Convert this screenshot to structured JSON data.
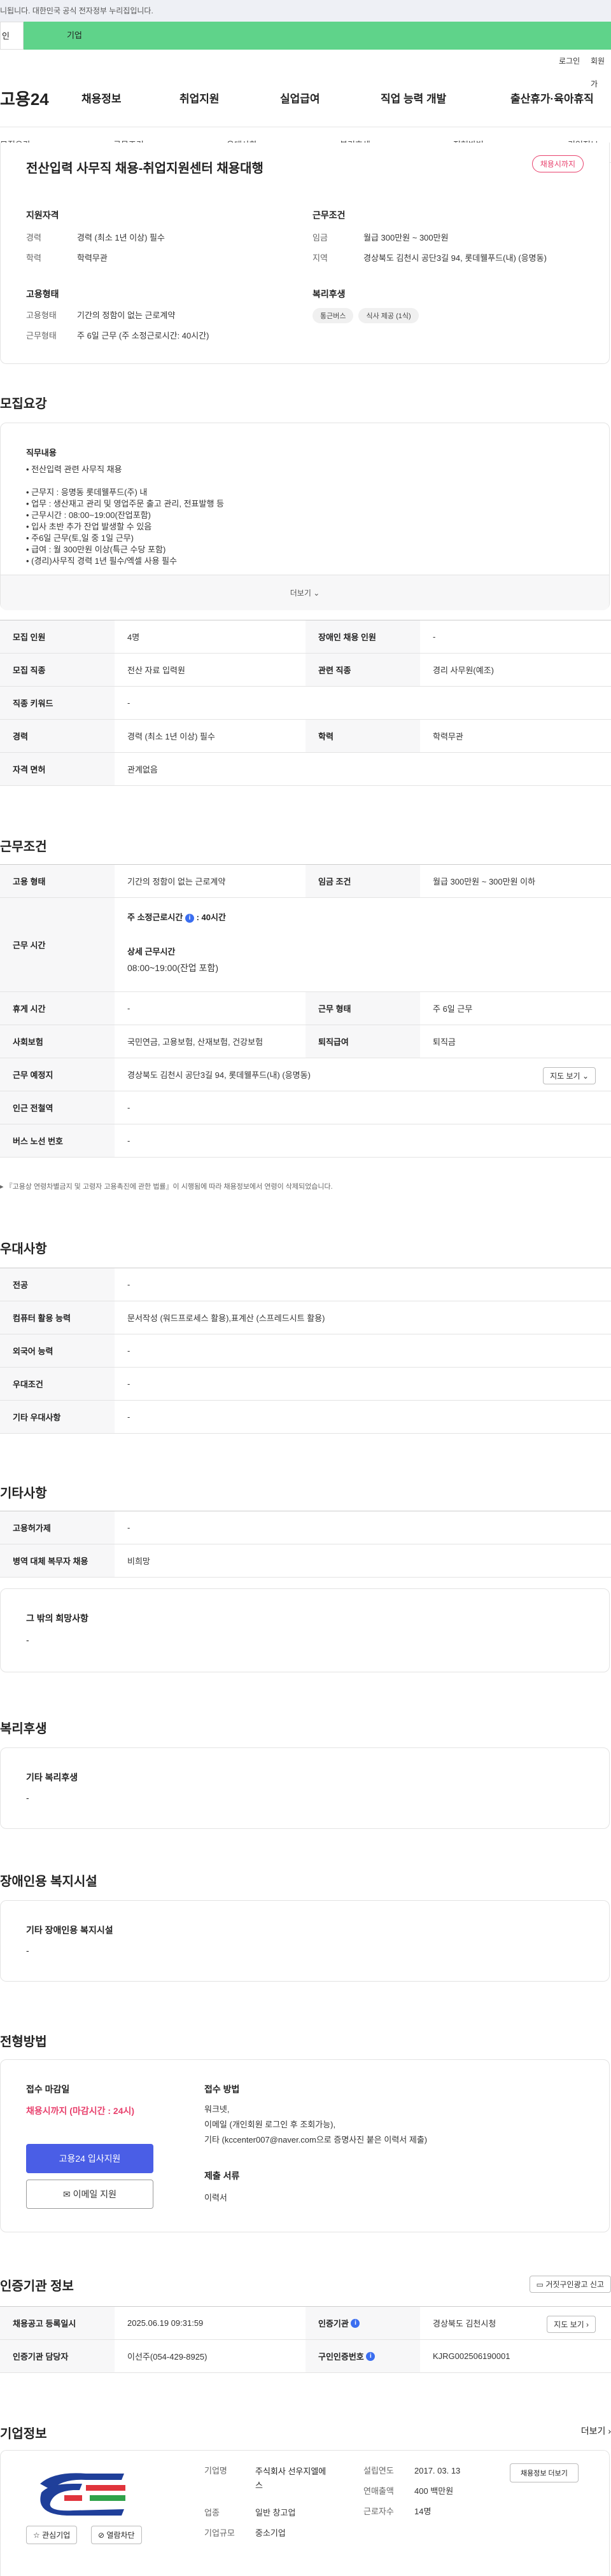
{
  "notice": "니됩니다. 대한민국 공식 전자정부 누리집입니다.",
  "tabs": {
    "individual": "인",
    "enterprise": "기업"
  },
  "util": {
    "login": "로그인",
    "join": "회원가"
  },
  "logo": "고용24",
  "gnb": [
    "채용정보",
    "취업지원",
    "실업급여",
    "직업 능력 개발",
    "출산휴가·육아휴직"
  ],
  "snb": [
    "모집요강",
    "근무조건",
    "우대사항",
    "복리후생",
    "전형방법",
    "기업정보"
  ],
  "job": {
    "title": "전산입력 사무직 채용-취업지원센터 채용대행",
    "badge": "채용시까지",
    "qual": {
      "heading": "지원자격",
      "rows": [
        {
          "k": "경력",
          "v": "경력 (최소 1년 이상) 필수"
        },
        {
          "k": "학력",
          "v": "학력무관"
        }
      ]
    },
    "cond": {
      "heading": "근무조건",
      "rows": [
        {
          "k": "임금",
          "v": "월급 300만원 ~ 300만원"
        },
        {
          "k": "지역",
          "v": "경상북도 김천시 공단3길 94, 롯데웰푸드(내) (응명동)"
        }
      ]
    },
    "emp": {
      "heading": "고용형태",
      "rows": [
        {
          "k": "고용형태",
          "v": "기간의 정함이 없는 근로계약"
        },
        {
          "k": "근무형태",
          "v": "주 6일 근무 (주 소정근로시간: 40시간)"
        }
      ]
    },
    "welfare": {
      "heading": "복리후생",
      "chips": [
        "통근버스",
        "식사 제공 (1식)"
      ]
    }
  },
  "recruit": {
    "heading": "모집요강",
    "desc_title": "직무내용",
    "desc_lines": [
      "• 전산입력 관련 사무직 채용",
      "",
      "• 근무지 : 응명동 롯데웰푸드(주) 내",
      "• 업무 : 생산재고 관리 및 영업주문 출고 관리, 전표발행 등",
      "• 근무시간 : 08:00~19:00(잔업포함)",
      "• 입사 초반 추가 잔업 발생할 수 있음",
      "• 주6일 근무(토,일 중 1일 근무)",
      "• 급여 : 월 300만원 이상(특근 수당 포함)",
      "• (경리)사무직 경력 1년 필수/엑셀 사용 필수"
    ],
    "more": "더보기",
    "rows": [
      {
        "l1": "모집 인원",
        "v1": "4명",
        "l2": "장애인 채용 인원",
        "v2": "-"
      },
      {
        "l1": "모집 직종",
        "v1": "전산 자료 입력원",
        "l2": "관련 직종",
        "v2": "경리 사무원(예조)"
      },
      {
        "l1": "직종 키워드",
        "v1": "-",
        "l2": "",
        "v2": ""
      },
      {
        "l1": "경력",
        "v1": "경력 (최소 1년 이상) 필수",
        "l2": "학력",
        "v2": "학력무관"
      },
      {
        "l1": "자격 면허",
        "v1": "관계없음",
        "l2": "",
        "v2": ""
      }
    ]
  },
  "work": {
    "heading": "근무조건",
    "r1": {
      "l1": "고용 형태",
      "v1": "기간의 정함이 없는 근로계약",
      "l2": "임금 조건",
      "v2": "월급 300만원 ~ 300만원 이하"
    },
    "hours": {
      "label": "근무 시간",
      "week_label": "주 소정근로시간",
      "week_val": ": 40시간",
      "detail_label": "상세 근무시간",
      "detail_val": "08:00~19:00(잔업 포함)"
    },
    "r3": {
      "l1": "휴게 시간",
      "v1": "-",
      "l2": "근무 형태",
      "v2": "주 6일 근무"
    },
    "r4": {
      "l1": "사회보험",
      "v1": "국민연금, 고용보험, 산재보험, 건강보험",
      "l2": "퇴직급여",
      "v2": "퇴직금"
    },
    "r5": {
      "l1": "근무 예정지",
      "v1": "경상북도 김천시 공단3길 94, 롯데웰푸드(내) (응명동)",
      "btn": "지도 보기"
    },
    "r6": {
      "l1": "인근 전철역",
      "v1": "-"
    },
    "r7": {
      "l1": "버스 노선 번호",
      "v1": "-"
    },
    "note": "『고용상 연령차별금지 및 고령자 고용촉진에 관한 법률』이 시행됨에 따라 채용정보에서 연령이 삭제되었습니다."
  },
  "pref": {
    "heading": "우대사항",
    "rows": [
      {
        "l": "전공",
        "v": "-"
      },
      {
        "l": "컴퓨터 활용 능력",
        "v": "문서작성 (워드프로세스 활용),표계산 (스프레드시트 활용)"
      },
      {
        "l": "외국어 능력",
        "v": "-"
      },
      {
        "l": "우대조건",
        "v": "-"
      },
      {
        "l": "기타 우대사항",
        "v": "-"
      }
    ]
  },
  "etc": {
    "heading": "기타사항",
    "rows": [
      {
        "l": "고용허가제",
        "v": "-"
      },
      {
        "l": "병역 대체 복무자 채용",
        "v": "비희망"
      }
    ],
    "wish_title": "그 밖의 희망사항",
    "wish_val": "-"
  },
  "welfare2": {
    "heading": "복리후생",
    "title": "기타 복리후생",
    "val": "-"
  },
  "disab": {
    "heading": "장애인용 복지시설",
    "title": "기타 장애인용 복지시설",
    "val": "-"
  },
  "process": {
    "heading": "전형방법",
    "deadline_title": "접수 마감일",
    "deadline_val": "채용시까지 (마감시간 : 24시)",
    "apply_btn": "고용24 입사지원",
    "email_btn": "이메일 지원",
    "method_title": "접수 방법",
    "method_lines": [
      "워크넷,",
      "이메일 (개인회원 로그인 후 조회가능),",
      "기타 (kccenter007@naver.com으로 증명사진 붙은 이력서 제출)"
    ],
    "docs_title": "제출 서류",
    "docs_val": "이력서"
  },
  "cert": {
    "heading": "인증기관 정보",
    "report_btn": "거짓구인광고 신고",
    "r1": {
      "l1": "채용공고 등록일시",
      "v1": "2025.06.19 09:31:59",
      "l2": "인증기관",
      "v2": "경상북도 김천시청",
      "btn": "지도 보기"
    },
    "r2": {
      "l1": "인증기관 담당자",
      "v1": "이선주(054-429-8925)",
      "l2": "구인인증번호",
      "v2": "KJRG002506190001"
    }
  },
  "company": {
    "heading": "기업정보",
    "more": "더보기",
    "interest_btn": "관심기업",
    "block_btn": "열람차단",
    "rows": [
      {
        "l": "기업명",
        "v": "주식회사 선우지엘에스"
      },
      {
        "l": "업종",
        "v": "일반 창고업"
      },
      {
        "l": "기업규모",
        "v": "중소기업"
      }
    ],
    "rows2": [
      {
        "l": "설립연도",
        "v": "2017. 03. 13"
      },
      {
        "l": "연매출액",
        "v": "400 백만원"
      },
      {
        "l": "근로자수",
        "v": "14명"
      }
    ],
    "jobs_btn": "채용정보 더보기"
  },
  "colors": {
    "accent": "#4a5ee6",
    "danger": "#e8416d",
    "enterprise_tab": "#5fd38a"
  }
}
